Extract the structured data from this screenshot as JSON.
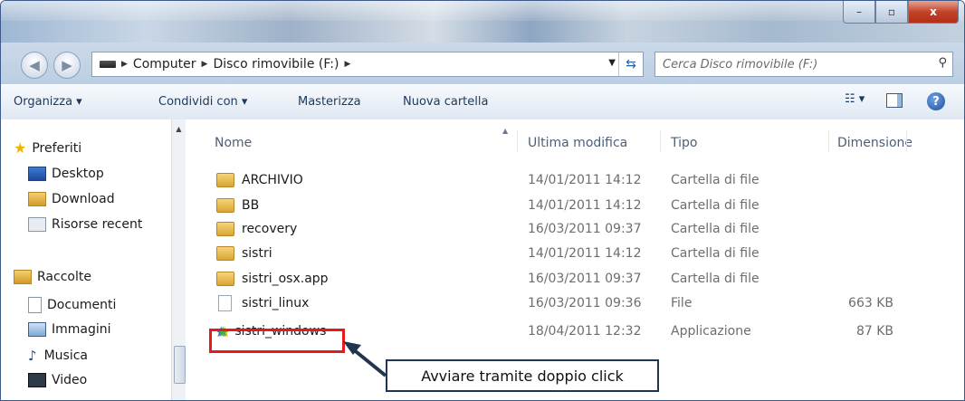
{
  "window": {
    "minimize_label": "–",
    "maximize_label": "▫",
    "close_label": "x"
  },
  "address": {
    "crumbs": [
      "Computer",
      "Disco rimovibile (F:)"
    ],
    "search_placeholder": "Cerca Disco rimovibile (F:)"
  },
  "toolbar": {
    "organize": "Organizza ▾",
    "share": "Condividi con ▾",
    "burn": "Masterizza",
    "new_folder": "Nuova cartella"
  },
  "sidebar": {
    "favorites_label": "Preferiti",
    "favorites": [
      "Desktop",
      "Download",
      "Risorse recent"
    ],
    "libraries_label": "Raccolte",
    "libraries": [
      "Documenti",
      "Immagini",
      "Musica",
      "Video"
    ]
  },
  "columns": {
    "name": "Nome",
    "date": "Ultima modifica",
    "type": "Tipo",
    "size": "Dimensione"
  },
  "files": [
    {
      "name": "ARCHIVIO",
      "date": "14/01/2011 14:12",
      "type": "Cartella di file",
      "size": "",
      "kind": "folder"
    },
    {
      "name": "BB",
      "date": "14/01/2011 14:12",
      "type": "Cartella di file",
      "size": "",
      "kind": "folder"
    },
    {
      "name": "recovery",
      "date": "16/03/2011 09:37",
      "type": "Cartella di file",
      "size": "",
      "kind": "folder"
    },
    {
      "name": "sistri",
      "date": "14/01/2011 14:12",
      "type": "Cartella di file",
      "size": "",
      "kind": "folder"
    },
    {
      "name": "sistri_osx.app",
      "date": "16/03/2011 09:37",
      "type": "Cartella di file",
      "size": "",
      "kind": "folder"
    },
    {
      "name": "sistri_linux",
      "date": "16/03/2011 09:36",
      "type": "File",
      "size": "663 KB",
      "kind": "file"
    },
    {
      "name": "sistri_windows",
      "date": "18/04/2011 12:32",
      "type": "Applicazione",
      "size": "87 KB",
      "kind": "app"
    }
  ],
  "annotation": {
    "callout_text": "Avviare tramite doppio click"
  },
  "colors": {
    "highlight": "#e21b1b",
    "callout_border": "#1f3550"
  }
}
